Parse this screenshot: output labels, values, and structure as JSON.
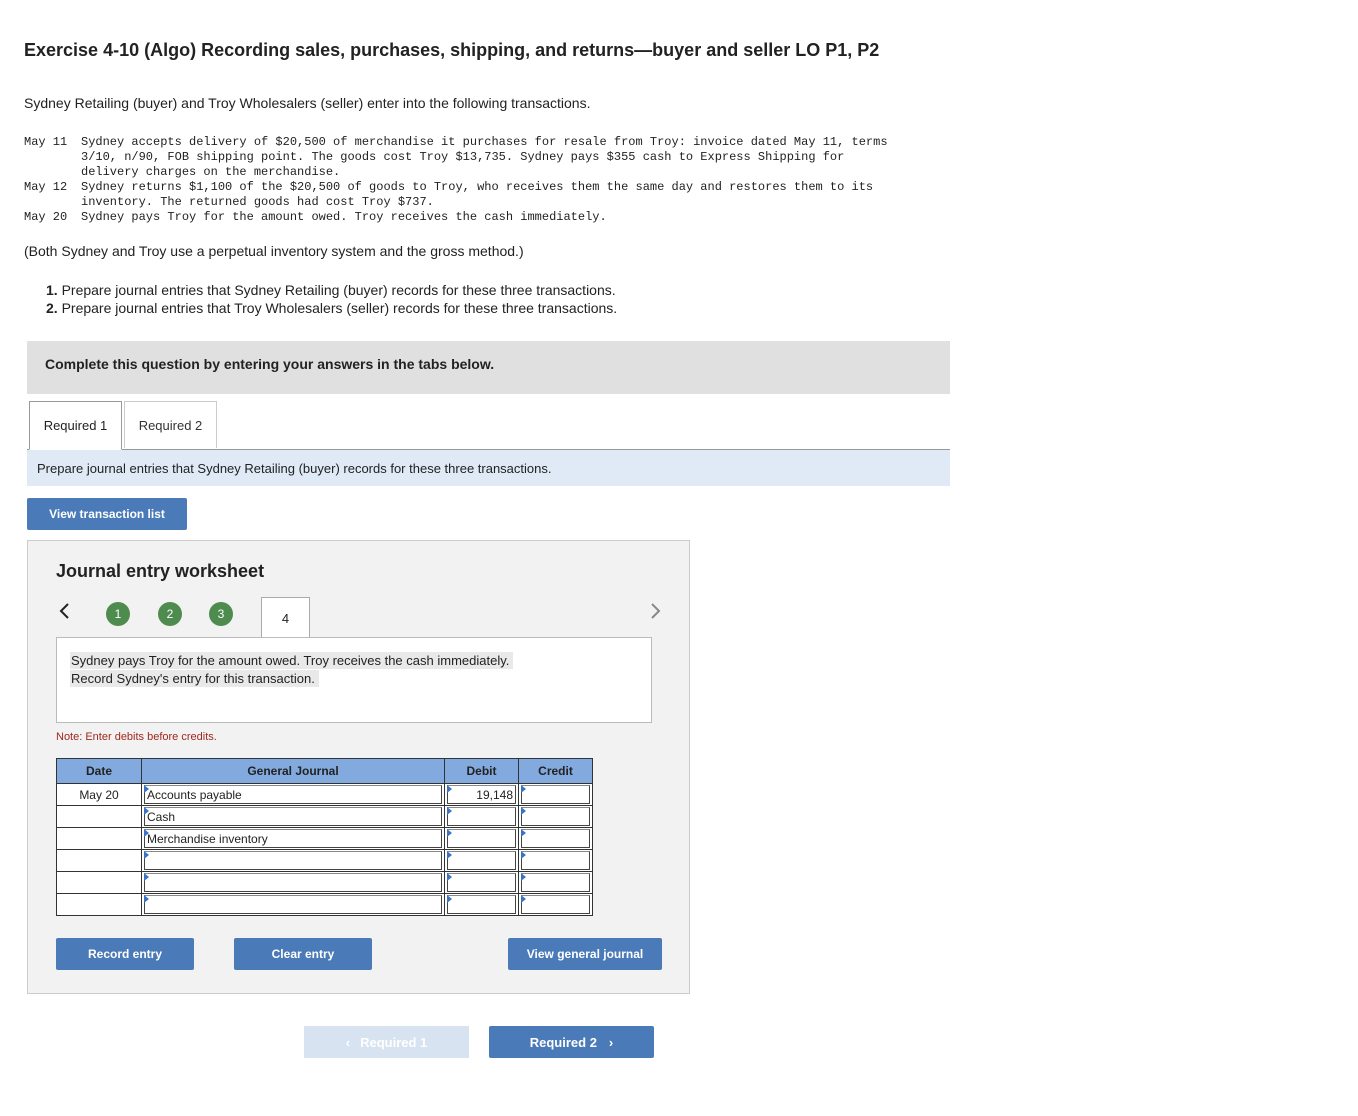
{
  "title": "Exercise 4-10 (Algo) Recording sales, purchases, shipping, and returns—buyer and seller LO P1, P2",
  "intro": "Sydney Retailing (buyer) and Troy Wholesalers (seller) enter into the following transactions.",
  "transactions": [
    {
      "date": "May 11",
      "lines": [
        "Sydney accepts delivery of $20,500 of merchandise it purchases for resale from Troy: invoice dated May 11, terms",
        "3/10, n/90, FOB shipping point. The goods cost Troy $13,735. Sydney pays $355 cash to Express Shipping for",
        "delivery charges on the merchandise."
      ]
    },
    {
      "date": "May 12",
      "lines": [
        "Sydney returns $1,100 of the $20,500 of goods to Troy, who receives them the same day and restores them to its",
        "inventory. The returned goods had cost Troy $737."
      ]
    },
    {
      "date": "May 20",
      "lines": [
        "Sydney pays Troy for the amount owed. Troy receives the cash immediately."
      ]
    }
  ],
  "method_note": "(Both Sydney and Troy use a perpetual inventory system and the gross method.)",
  "requirements": [
    {
      "num": "1.",
      "text": "Prepare journal entries that Sydney Retailing (buyer) records for these three transactions."
    },
    {
      "num": "2.",
      "text": "Prepare journal entries that Troy Wholesalers (seller) records for these three transactions."
    }
  ],
  "complete_banner": "Complete this question by entering your answers in the tabs below.",
  "tabs": [
    "Required 1",
    "Required 2"
  ],
  "tab_instruction": "Prepare journal entries that Sydney Retailing (buyer) records for these three transactions.",
  "view_transaction_list": "View transaction list",
  "worksheet": {
    "title": "Journal entry worksheet",
    "steps": [
      "1",
      "2",
      "3",
      "4"
    ],
    "description": [
      "Sydney pays Troy for the amount owed. Troy receives the cash immediately.",
      "Record Sydney's entry for this transaction."
    ],
    "note": "Note: Enter debits before credits.",
    "headers": {
      "date": "Date",
      "journal": "General Journal",
      "debit": "Debit",
      "credit": "Credit"
    },
    "rows": [
      {
        "date": "May 20",
        "account": "Accounts payable",
        "debit": "19,148",
        "credit": ""
      },
      {
        "date": "",
        "account": "Cash",
        "debit": "",
        "credit": ""
      },
      {
        "date": "",
        "account": "Merchandise inventory",
        "debit": "",
        "credit": ""
      },
      {
        "date": "",
        "account": "",
        "debit": "",
        "credit": ""
      },
      {
        "date": "",
        "account": "",
        "debit": "",
        "credit": ""
      },
      {
        "date": "",
        "account": "",
        "debit": "",
        "credit": ""
      }
    ],
    "record_entry": "Record entry",
    "clear_entry": "Clear entry",
    "view_general_journal": "View general journal"
  },
  "bottom_nav": {
    "prev": "Required 1",
    "next": "Required 2"
  }
}
